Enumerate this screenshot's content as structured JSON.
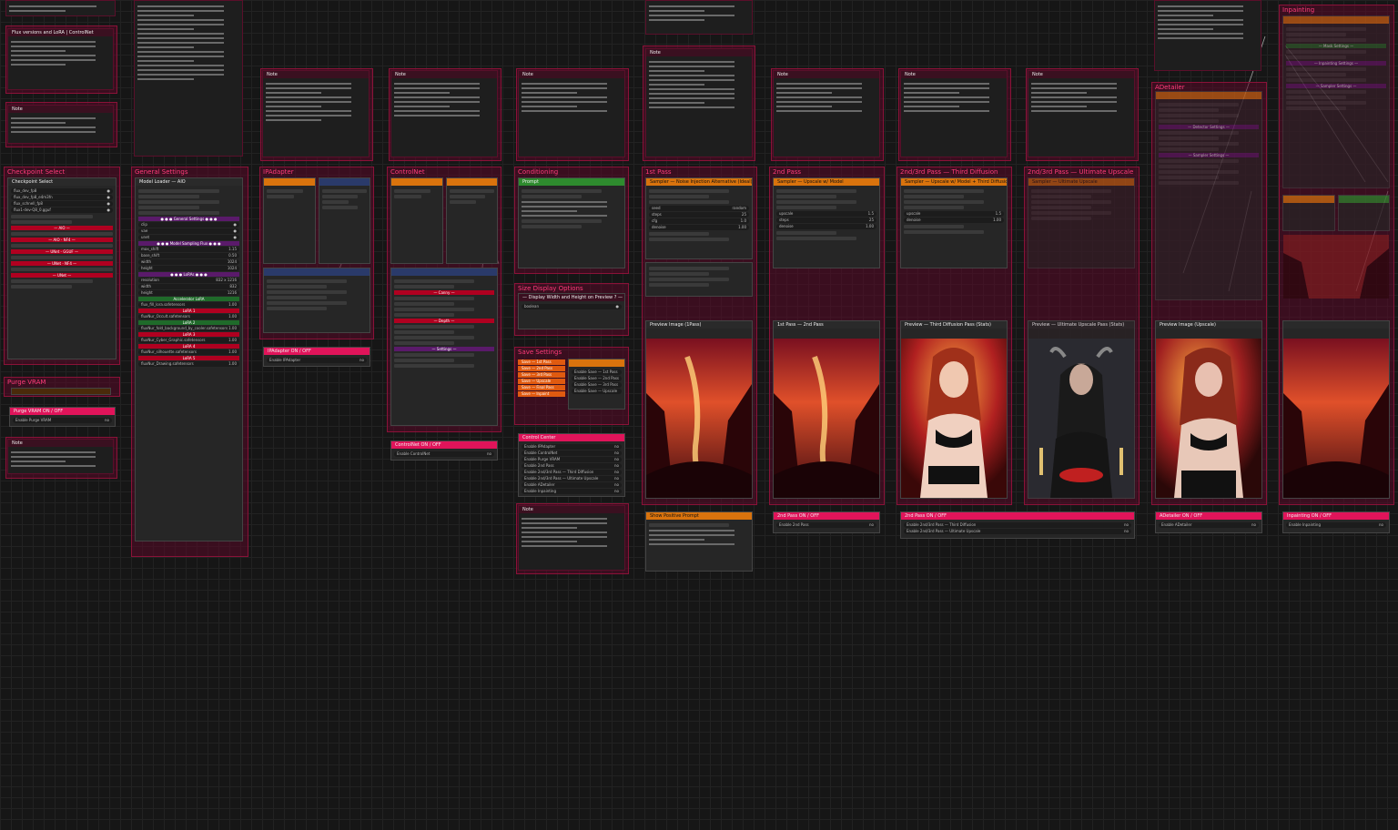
{
  "canvas": {
    "background": "#161616",
    "group_color": "#8a1238",
    "title_color": "#ff3b7a"
  },
  "groups": {
    "checkpoint": "Checkpoint Select",
    "general": "General Settings",
    "ipadapter": "IPAdapter",
    "controlnet": "ControlNet",
    "conditioning": "Conditioning",
    "pass1": "1st Pass",
    "pass2": "2nd Pass",
    "pass23": "2nd/3rd Pass — Third Diffusion",
    "pass23u": "2nd/3rd Pass — Ultimate Upscale",
    "adetailer": "ADetailer",
    "facefix": "Inpainting",
    "purge": "Purge VRAM",
    "display": "Size Display Options",
    "save": "Save Settings"
  },
  "nodes": {
    "flux_versions_note": "Flux versions and LoRA | ControlNet",
    "note": "Note",
    "note_a": "Note",
    "checkpoint_select": "Checkpoint Select",
    "model_loader": "Model Loader — AIO",
    "general_settings_sep": "● ● ● General Settings ● ● ●",
    "model_sampling_sep": "● ● ● Model Sampling Flux ● ● ●",
    "lora_sep": "● ● ● LoRAs ● ● ●",
    "accelerator_lora": "Accelerator LoRA",
    "lora1": "LoRA 1",
    "lora2": "LoRA 2",
    "lora3": "LoRA 3",
    "lora4": "LoRA 4",
    "lora5": "LoRA 5",
    "prompt": "Prompt",
    "sampler1": "Sampler — Noise Injection Alternative (Ideal)",
    "sampler2": "Sampler — Upscale w/ Model",
    "sampler3": "Sampler — Upscale w/ Model + Third Diffusion",
    "sampler4": "Sampler — Ultimate Upscale",
    "preview1": "Preview Image (1Pass)",
    "preview2": "1st Pass — 2nd Pass",
    "preview3": "Preview — Third Diffusion Pass (Stats)",
    "preview4": "Preview — Ultimate Upscale Pass (Stats)",
    "preview5": "Preview Image (Upscale)",
    "purge_toggle": "Purge VRAM ON / OFF",
    "ipadapter_toggle": "IPAdapter ON / OFF",
    "controlnet_toggle": "ControlNet ON / OFF",
    "control_center": "Control Center",
    "pass2_toggle": "2nd Pass ON / OFF",
    "pass23_toggle": "2nd Pass ON / OFF",
    "adetailer_toggle": "ADetailer ON / OFF",
    "inpaint_toggle": "Inpainting ON / OFF",
    "show_prompt": "Show Positive Prompt",
    "display_note": "— Display Width and Height on Preview ? —"
  },
  "toggles": {
    "opt": "OPT_CONNECTION",
    "purge": "Enable Purge VRAM",
    "ipadapter": "Enable IPAdapter",
    "controlnet": "Enable ControlNet",
    "pass2": "Enable 2nd Pass",
    "pass3a": "Enable 2nd/3rd Pass — Third Diffusion",
    "pass3b": "Enable 2nd/3rd Pass — Ultimate Upscale",
    "adetailer": "Enable ADetailer",
    "inpaint": "Enable Inpainting"
  },
  "control_center_items": [
    "Enable IPAdapter",
    "Enable ControlNet",
    "Enable Purge VRAM",
    "Enable 2nd Pass",
    "Enable 2nd/3rd Pass — Third Diffusion",
    "Enable 2nd/3rd Pass — Ultimate Upscale",
    "Enable ADetailer",
    "Enable Inpainting"
  ],
  "save_buttons": [
    "Save — 1st Pass",
    "Save — 2nd Pass",
    "Save — 3rd Pass",
    "Save — Upscale",
    "Save — Final Pass",
    "Save — Inpaint"
  ],
  "save_toggles": [
    "Enable Save — 1st Pass",
    "Enable Save — 2nd Pass",
    "Enable Save — 3rd Pass",
    "Enable Save — Upscale"
  ],
  "lora_names": [
    "flux_fill_lora.safetensors",
    "fluxNur_Occult.safetensors",
    "fluxNur_fold_background_by_cooler.safetensors",
    "fluxNur_Cyber_Graphic.safetensors",
    "fluxNur_silhouette.safetensors",
    "fluxNur_Drawing.safetensors"
  ],
  "checkpoints": [
    "flux_dev_fp8",
    "flux_dev_fp8_e4m3fn",
    "flux_schnell_fp8",
    "flux1-dev-Q8_0.gguf"
  ],
  "sampler_values": {
    "seed": "random",
    "steps": "25",
    "cfg": "1.0",
    "denoise": "1.00",
    "upscale": "1.5"
  }
}
